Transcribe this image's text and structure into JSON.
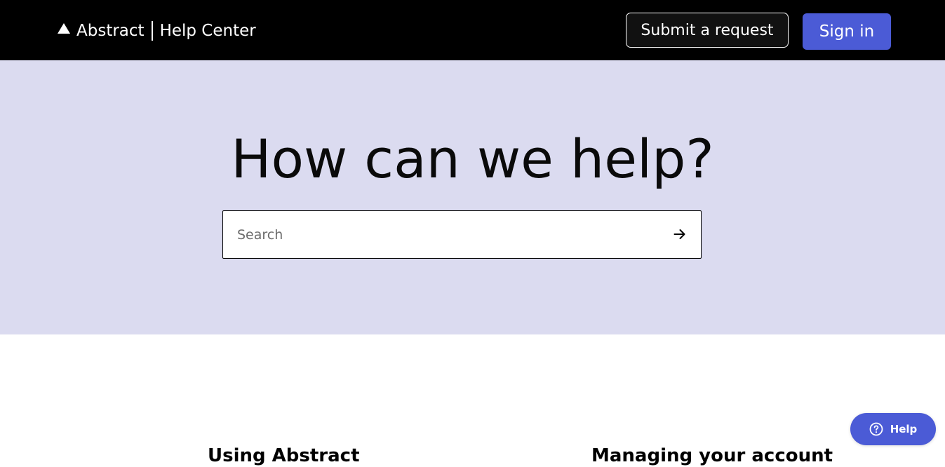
{
  "header": {
    "brand_name": "Abstract",
    "brand_section": "Help Center",
    "submit_request_label": "Submit a request",
    "sign_in_label": "Sign in",
    "logo_icon": "triangle-logo-icon"
  },
  "hero": {
    "title": "How can we help?",
    "search": {
      "placeholder": "Search",
      "value": "",
      "submit_icon": "arrow-right-icon"
    }
  },
  "sections": [
    {
      "heading": "Using Abstract"
    },
    {
      "heading": "Managing your account"
    }
  ],
  "help_widget": {
    "label": "Help",
    "icon": "question-circle-icon"
  },
  "colors": {
    "header_bg": "#000000",
    "hero_bg": "#dbdbf0",
    "accent": "#4b5bd6",
    "text": "#0a0a0a"
  }
}
